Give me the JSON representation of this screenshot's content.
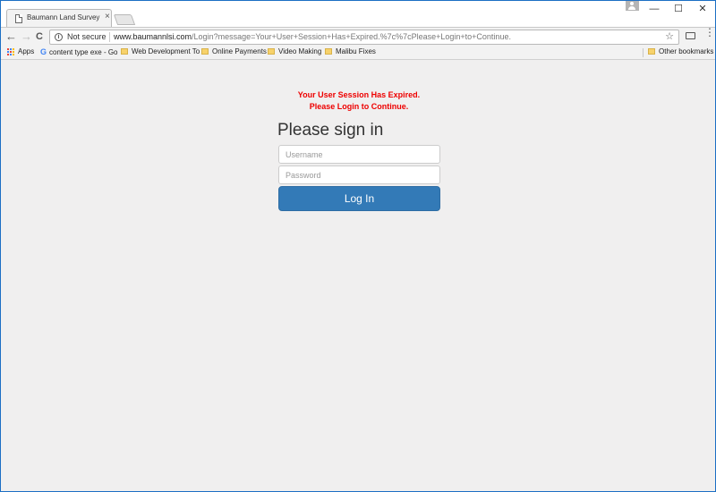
{
  "browser": {
    "tab_title": "Baumann Land Survey In",
    "tab_close": "×",
    "window_controls": {
      "minimize": "—",
      "maximize": "☐",
      "close": "✕"
    },
    "security_label": "Not secure",
    "url_host": "www.baumannlsi.com",
    "url_path": "/Login?message=Your+User+Session+Has+Expired.%7c%7cPlease+Login+to+Continue.",
    "nav": {
      "back": "←",
      "forward": "→",
      "reload": "C"
    },
    "star": "☆",
    "menu": "⋮"
  },
  "bookmarks": {
    "apps": "Apps",
    "items": [
      {
        "label": "content type exe - Go",
        "icon": "google-icon"
      },
      {
        "label": "Web Development To",
        "icon": "folder-icon"
      },
      {
        "label": "Online Payments",
        "icon": "folder-icon"
      },
      {
        "label": "Video Making",
        "icon": "folder-icon"
      },
      {
        "label": "Malibu Fixes",
        "icon": "folder-icon"
      }
    ],
    "other": "Other bookmarks"
  },
  "page": {
    "message_line1": "Your User Session Has Expired.",
    "message_line2": "Please Login to Continue.",
    "heading": "Please sign in",
    "username_placeholder": "Username",
    "password_placeholder": "Password",
    "login_label": "Log In"
  },
  "colors": {
    "error": "#ee0000",
    "primary": "#337ab7"
  }
}
